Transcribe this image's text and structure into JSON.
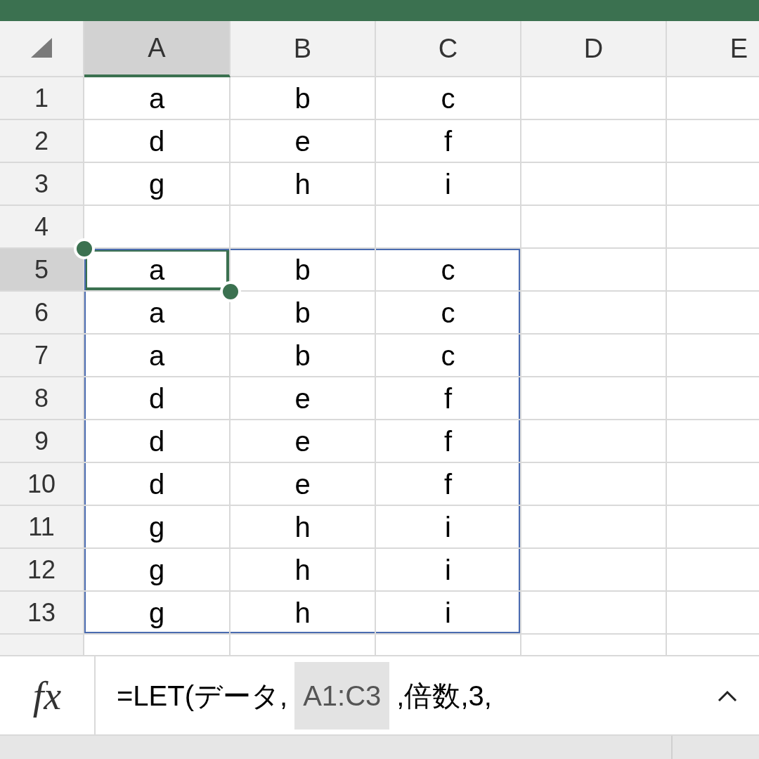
{
  "columns": [
    {
      "label": "A",
      "selected": true
    },
    {
      "label": "B",
      "selected": false
    },
    {
      "label": "C",
      "selected": false
    },
    {
      "label": "D",
      "selected": false
    },
    {
      "label": "E",
      "selected": false
    }
  ],
  "rows": [
    {
      "label": "1",
      "kind": "value",
      "selected": false,
      "cells": [
        "a",
        "b",
        "c"
      ]
    },
    {
      "label": "2",
      "kind": "value",
      "selected": false,
      "cells": [
        "d",
        "e",
        "f"
      ]
    },
    {
      "label": "3",
      "kind": "value",
      "selected": false,
      "cells": [
        "g",
        "h",
        "i"
      ]
    },
    {
      "label": "4",
      "kind": "value",
      "selected": false,
      "cells": []
    },
    {
      "label": "5",
      "kind": "spill",
      "selected": true,
      "cells": [
        "a",
        "b",
        "c"
      ]
    },
    {
      "label": "6",
      "kind": "spill",
      "selected": false,
      "cells": [
        "a",
        "b",
        "c"
      ]
    },
    {
      "label": "7",
      "kind": "spill",
      "selected": false,
      "cells": [
        "a",
        "b",
        "c"
      ]
    },
    {
      "label": "8",
      "kind": "spill",
      "selected": false,
      "cells": [
        "d",
        "e",
        "f"
      ]
    },
    {
      "label": "9",
      "kind": "spill",
      "selected": false,
      "cells": [
        "d",
        "e",
        "f"
      ]
    },
    {
      "label": "10",
      "kind": "spill",
      "selected": false,
      "cells": [
        "d",
        "e",
        "f"
      ]
    },
    {
      "label": "11",
      "kind": "spill",
      "selected": false,
      "cells": [
        "g",
        "h",
        "i"
      ]
    },
    {
      "label": "12",
      "kind": "spill",
      "selected": false,
      "cells": [
        "g",
        "h",
        "i"
      ]
    },
    {
      "label": "13",
      "kind": "spill",
      "selected": false,
      "cells": [
        "g",
        "h",
        "i"
      ]
    }
  ],
  "formula_bar": {
    "function_label": "fx",
    "parts": [
      {
        "kind": "text",
        "text": "=LET(データ,"
      },
      {
        "kind": "reference",
        "text": "A1:C3"
      },
      {
        "kind": "text",
        "text": ",倍数,3,"
      }
    ]
  }
}
